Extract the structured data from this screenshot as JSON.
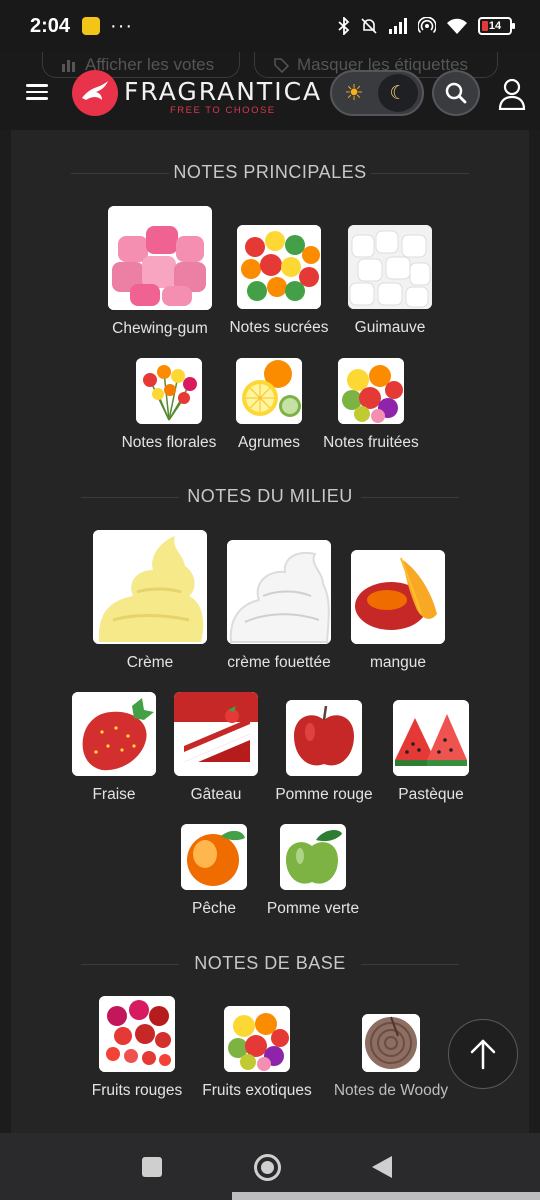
{
  "status": {
    "time": "2:04",
    "dots": "···",
    "battery": "14"
  },
  "header": {
    "ghost_votes": "Afficher les votes",
    "ghost_tags": "Masquer les étiquettes",
    "logo_name": "FRAGRANTICA",
    "logo_tagline": "FREE TO CHOOSE"
  },
  "sections": {
    "top": {
      "title": "NOTES PRINCIPALES",
      "notes": [
        {
          "label": "Chewing-gum"
        },
        {
          "label": "Notes sucrées"
        },
        {
          "label": "Guimauve"
        },
        {
          "label": "Notes florales"
        },
        {
          "label": "Agrumes"
        },
        {
          "label": "Notes fruitées"
        }
      ]
    },
    "middle": {
      "title": "NOTES DU MILIEU",
      "notes": [
        {
          "label": "Crème"
        },
        {
          "label": "crème fouettée"
        },
        {
          "label": "mangue"
        },
        {
          "label": "Fraise"
        },
        {
          "label": "Gâteau"
        },
        {
          "label": "Pomme rouge"
        },
        {
          "label": "Pastèque"
        },
        {
          "label": "Pêche"
        },
        {
          "label": "Pomme verte"
        }
      ]
    },
    "base": {
      "title": "NOTES DE BASE",
      "notes": [
        {
          "label": "Fruits rouges"
        },
        {
          "label": "Fruits exotiques"
        },
        {
          "label": "Notes de Woody"
        }
      ]
    }
  },
  "colors": {
    "accent": "#e8334a",
    "panel": "#252526",
    "background": "#1c1c1d"
  }
}
